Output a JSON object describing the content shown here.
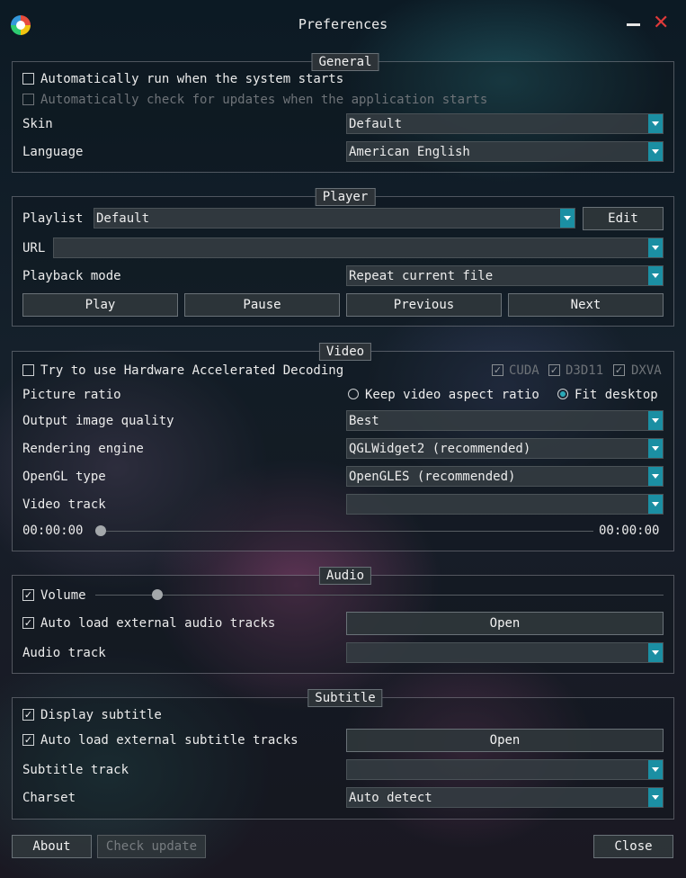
{
  "window": {
    "title": "Preferences",
    "close_glyph": "✕"
  },
  "general": {
    "title": "General",
    "autorun_label": "Automatically run when the system starts",
    "autorun_checked": false,
    "check_updates_label": "Automatically check for updates when the application starts",
    "check_updates_checked": false,
    "skin_label": "Skin",
    "skin_value": "Default",
    "language_label": "Language",
    "language_value": "American English"
  },
  "player": {
    "title": "Player",
    "playlist_label": "Playlist",
    "playlist_value": "Default",
    "edit_label": "Edit",
    "url_label": "URL",
    "url_value": "",
    "playback_mode_label": "Playback mode",
    "playback_mode_value": "Repeat current file",
    "play_label": "Play",
    "pause_label": "Pause",
    "previous_label": "Previous",
    "next_label": "Next"
  },
  "video": {
    "title": "Video",
    "hw_decoding_label": "Try to use Hardware Accelerated Decoding",
    "hw_decoding_checked": false,
    "cuda_label": "CUDA",
    "d3d11_label": "D3D11",
    "dxva_label": "DXVA",
    "picture_ratio_label": "Picture ratio",
    "keep_aspect_label": "Keep video aspect ratio",
    "fit_desktop_label": "Fit desktop",
    "selected_ratio": "Fit desktop",
    "output_quality_label": "Output image quality",
    "output_quality_value": "Best",
    "rendering_engine_label": "Rendering engine",
    "rendering_engine_value": "QGLWidget2 (recommended)",
    "opengl_type_label": "OpenGL type",
    "opengl_type_value": "OpenGLES (recommended)",
    "video_track_label": "Video track",
    "video_track_value": "",
    "position_current": "00:00:00",
    "position_total": "00:00:00",
    "position_fraction": 0
  },
  "audio": {
    "title": "Audio",
    "volume_label": "Volume",
    "volume_checked": true,
    "volume_fraction": 0.1,
    "auto_load_label": "Auto load external audio tracks",
    "auto_load_checked": true,
    "open_label": "Open",
    "audio_track_label": "Audio track",
    "audio_track_value": ""
  },
  "subtitle": {
    "title": "Subtitle",
    "display_label": "Display subtitle",
    "display_checked": true,
    "auto_load_label": "Auto load external subtitle tracks",
    "auto_load_checked": true,
    "open_label": "Open",
    "subtitle_track_label": "Subtitle track",
    "subtitle_track_value": "",
    "charset_label": "Charset",
    "charset_value": "Auto detect"
  },
  "footer": {
    "about_label": "About",
    "check_update_label": "Check update",
    "close_label": "Close"
  },
  "colors": {
    "accent": "#1b8fa3",
    "close_icon": "#e03a3a"
  },
  "glyphs": {
    "check": "✓"
  }
}
